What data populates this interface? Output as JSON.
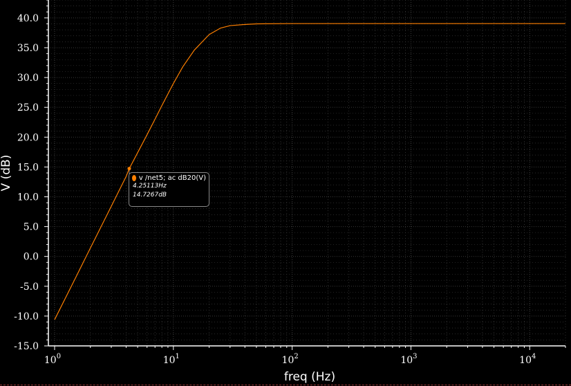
{
  "chart_data": {
    "type": "line",
    "xscale": "log",
    "xlabel": "freq (Hz)",
    "ylabel": "V (dB)",
    "xlim": [
      1,
      20000
    ],
    "ylim": [
      -15,
      43
    ],
    "y_ticks": [
      "40.0",
      "35.0",
      "30.0",
      "25.0",
      "20.0",
      "15.0",
      "10.0",
      "5.0",
      "0.0",
      "-5.0",
      "-10.0",
      "-15.0"
    ],
    "x_ticks": [
      {
        "value": 1,
        "base": "10",
        "exp": "0"
      },
      {
        "value": 10,
        "base": "10",
        "exp": "1"
      },
      {
        "value": 100,
        "base": "10",
        "exp": "2"
      },
      {
        "value": 1000,
        "base": "10",
        "exp": "3"
      },
      {
        "value": 10000,
        "base": "10",
        "exp": "4"
      }
    ],
    "grid": true,
    "background": "#000000",
    "grid_color": "#3a3a3a",
    "series": [
      {
        "color": "#ff8000",
        "points": [
          [
            1,
            -10.6
          ],
          [
            1.5,
            -3.6
          ],
          [
            2,
            1.4
          ],
          [
            3,
            8.4
          ],
          [
            4,
            13.4
          ],
          [
            4.25113,
            14.7267
          ],
          [
            5,
            17.4
          ],
          [
            6,
            20.4
          ],
          [
            7,
            23.0
          ],
          [
            8,
            25.3
          ],
          [
            10,
            29.0
          ],
          [
            12,
            31.8
          ],
          [
            15,
            34.6
          ],
          [
            20,
            37.2
          ],
          [
            25,
            38.3
          ],
          [
            30,
            38.7
          ],
          [
            40,
            38.9
          ],
          [
            50,
            39.0
          ],
          [
            100,
            39.05
          ],
          [
            1000,
            39.05
          ],
          [
            10000,
            39.05
          ],
          [
            20000,
            39.05
          ]
        ]
      }
    ],
    "annotations": [
      {
        "x": 4.25113,
        "y": 14.7267,
        "label": "v /net5; ac dB20(V)",
        "x_text": "4.25113Hz",
        "y_text": "14.7267dB"
      }
    ]
  }
}
